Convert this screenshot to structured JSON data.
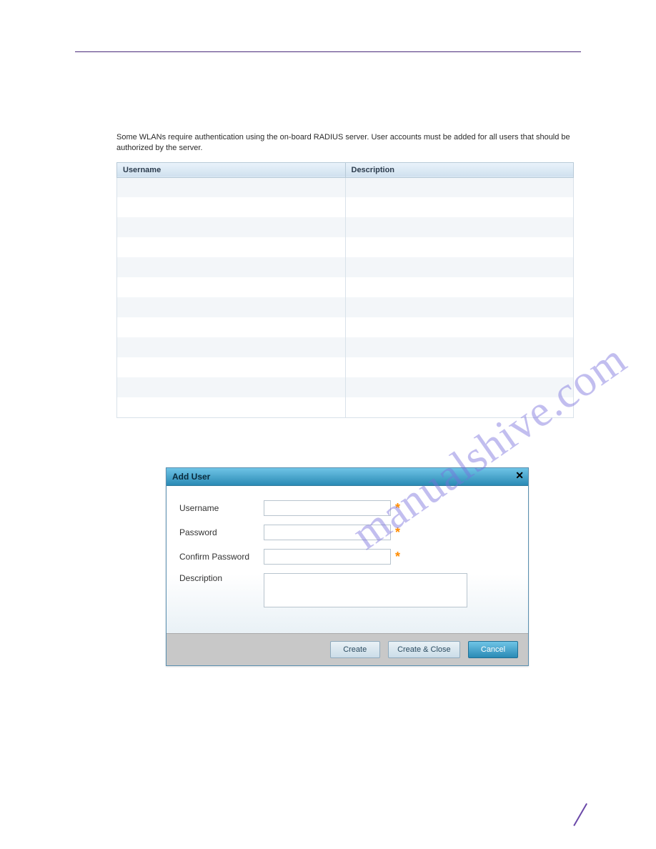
{
  "intro": "Some WLANs require authentication using the on-board RADIUS server.  User accounts must be added for all users that should be authorized by the server.",
  "table": {
    "headers": {
      "username": "Username",
      "description": "Description"
    }
  },
  "dialog": {
    "title": "Add User",
    "fields": {
      "username_label": "Username",
      "password_label": "Password",
      "confirm_label": "Confirm Password",
      "description_label": "Description",
      "username_value": "",
      "password_value": "",
      "confirm_value": "",
      "description_value": ""
    },
    "required_mark": "*",
    "buttons": {
      "create": "Create",
      "create_close": "Create & Close",
      "cancel": "Cancel"
    }
  },
  "watermark": "manualshive.com"
}
